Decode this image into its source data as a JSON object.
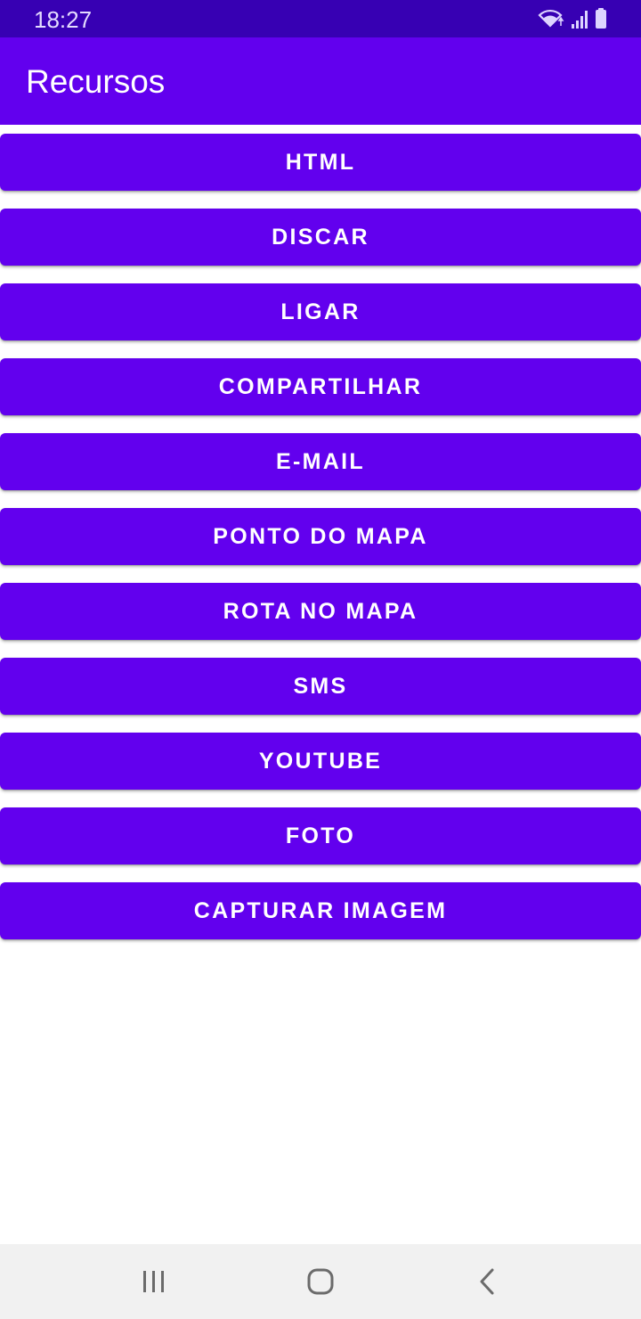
{
  "status_bar": {
    "time": "18:27",
    "icons": [
      "wifi-icon",
      "signal-icon",
      "battery-icon"
    ],
    "background": "#3700b3"
  },
  "app_bar": {
    "title": "Recursos",
    "background": "#6200ee"
  },
  "buttons": [
    {
      "label": "HTML"
    },
    {
      "label": "DISCAR"
    },
    {
      "label": "LIGAR"
    },
    {
      "label": "COMPARTILHAR"
    },
    {
      "label": "E-MAIL"
    },
    {
      "label": "PONTO DO MAPA"
    },
    {
      "label": "ROTA NO MAPA"
    },
    {
      "label": "SMS"
    },
    {
      "label": "YOUTUBE"
    },
    {
      "label": "FOTO"
    },
    {
      "label": "CAPTURAR IMAGEM"
    }
  ],
  "button_color": "#6200ee",
  "nav_bar": {
    "items": [
      "recent-apps-icon",
      "home-icon",
      "back-icon"
    ]
  }
}
